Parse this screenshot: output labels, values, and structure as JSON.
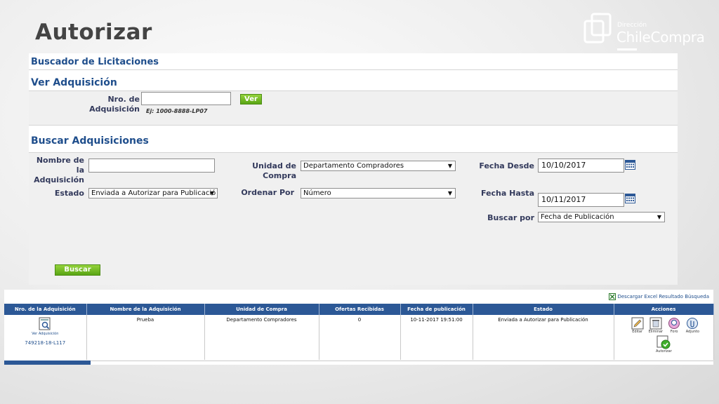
{
  "slide": {
    "title": "Autorizar"
  },
  "logo": {
    "small": "Dirección",
    "big": "ChileCompra"
  },
  "buscador": {
    "title": "Buscador de Licitaciones"
  },
  "ver": {
    "title": "Ver Adquisición",
    "nro_label": "Nro. de Adquisición",
    "nro_value": "",
    "hint": "Ej: 1000-8888-LP07",
    "button": "Ver"
  },
  "buscar": {
    "title": "Buscar Adquisiciones",
    "nombre_label_1": "Nombre de la",
    "nombre_label_2": "Adquisición",
    "nombre_value": "",
    "unidad_label": "Unidad de Compra",
    "unidad_value": "Departamento Compradores",
    "fecha_desde_label": "Fecha Desde",
    "fecha_desde_value": "10/10/2017",
    "estado_label": "Estado",
    "estado_value": "Enviada a Autorizar para Publicació",
    "ordenar_label": "Ordenar Por",
    "ordenar_value": "Número",
    "fecha_hasta_label": "Fecha Hasta",
    "fecha_hasta_value": "10/11/2017",
    "buscar_por_label": "Buscar por",
    "buscar_por_value": "Fecha de Publicación",
    "button": "Buscar"
  },
  "results": {
    "excel_link": "Descargar Excel Resultado Búsqueda",
    "headers": [
      "Nro. de la Adquisición",
      "Nombre de la Adquisición",
      "Unidad de Compra",
      "Ofertas Recibidas",
      "Fecha de publicación",
      "Estado",
      "Acciones"
    ],
    "row": {
      "ver_label": "Ver Adquisición",
      "nro": "749218-18-L117",
      "nombre": "Prueba",
      "unidad": "Departamento Compradores",
      "ofertas": "0",
      "fecha": "10-11-2017 19:51:00",
      "estado": "Enviada a Autorizar para Publicación"
    },
    "actions": {
      "editar": "Editar",
      "eliminar": "Eliminar",
      "foro": "Foro",
      "adjunto": "Adjunto",
      "autorizar": "Autorizar"
    }
  }
}
